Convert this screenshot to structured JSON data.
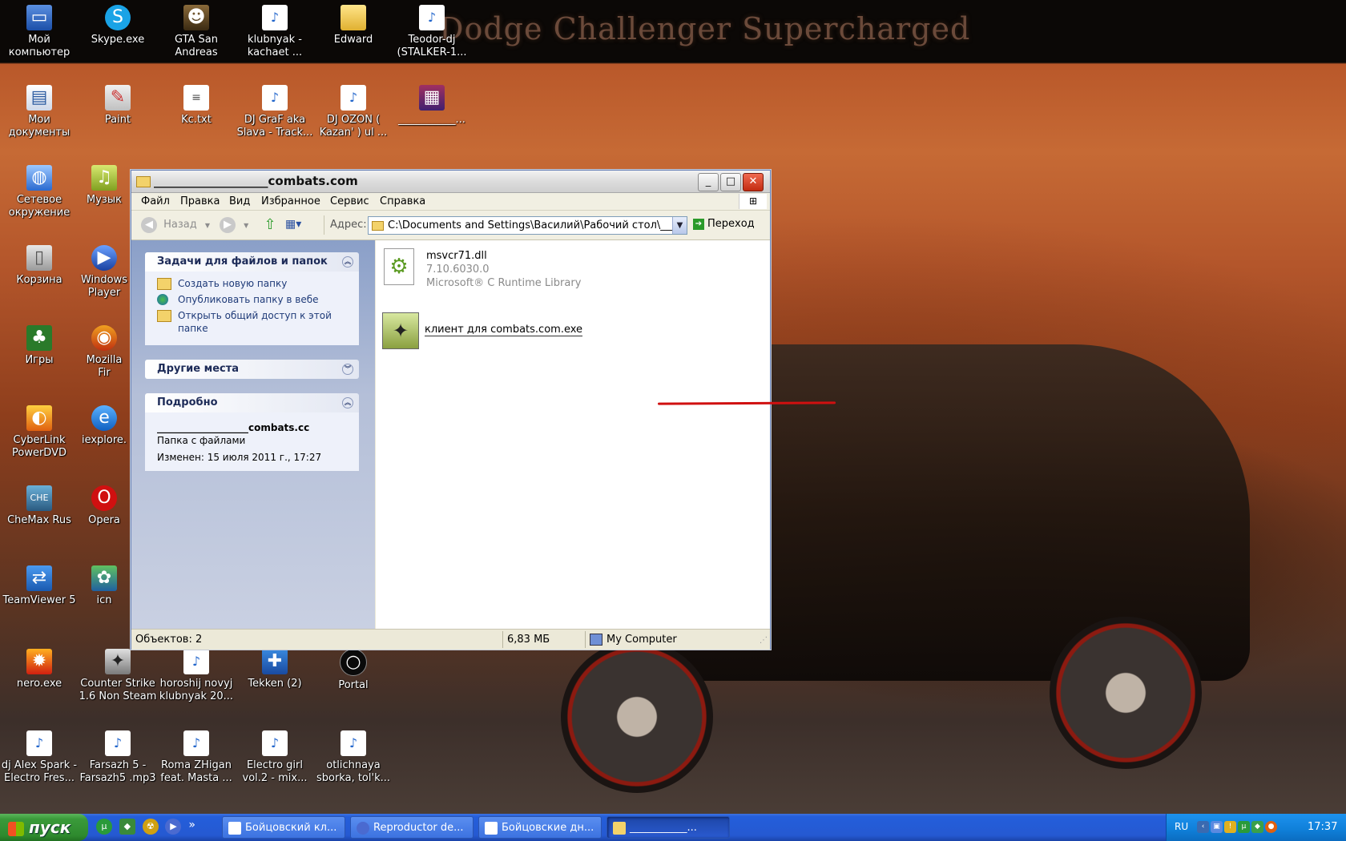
{
  "wallpaper": {
    "banner": "Dodge Challenger Supercharged"
  },
  "desktop": {
    "icons": [
      {
        "label": "Мой компьютер",
        "icon": "computer-icon"
      },
      {
        "label": "Skype.exe",
        "icon": "skype-icon"
      },
      {
        "label": "GTA San Andreas",
        "icon": "game-icon"
      },
      {
        "label": "klubnyak - kachaet ...",
        "icon": "mp3-icon"
      },
      {
        "label": "Edward",
        "icon": "folder-icon"
      },
      {
        "label": "Teodor-dj (STALKER-1...",
        "icon": "mp3-icon"
      },
      {
        "label": "Мои документы",
        "icon": "documents-icon"
      },
      {
        "label": "Paint",
        "icon": "paint-icon"
      },
      {
        "label": "Kc.txt",
        "icon": "text-file-icon"
      },
      {
        "label": "DJ GraF aka Slava - Track...",
        "icon": "mp3-icon"
      },
      {
        "label": "DJ OZON ( Kazan' ) ul ...",
        "icon": "mp3-icon"
      },
      {
        "label": "___________...",
        "icon": "archive-icon"
      },
      {
        "label": "Сетевое окружение",
        "icon": "network-icon"
      },
      {
        "label": "Музык",
        "icon": "music-icon"
      },
      {
        "label": "Корзина",
        "icon": "recycle-bin-icon"
      },
      {
        "label": "Windows Player",
        "icon": "media-player-icon"
      },
      {
        "label": "Игры",
        "icon": "games-icon"
      },
      {
        "label": "Mozilla Fir",
        "icon": "firefox-icon"
      },
      {
        "label": "CyberLink PowerDVD",
        "icon": "powerdvd-icon"
      },
      {
        "label": "iexplore.",
        "icon": "internet-explorer-icon"
      },
      {
        "label": "CheMax Rus",
        "icon": "chemax-icon"
      },
      {
        "label": "Opera",
        "icon": "opera-icon"
      },
      {
        "label": "TeamViewer 5",
        "icon": "teamviewer-icon"
      },
      {
        "label": "icn",
        "icon": "icn-icon"
      },
      {
        "label": "nero.exe",
        "icon": "nero-icon"
      },
      {
        "label": "Counter Strike 1.6 Non Steam",
        "icon": "counter-strike-icon"
      },
      {
        "label": "horoshij novyj klubnyak 20...",
        "icon": "mp3-icon"
      },
      {
        "label": "Tekken (2)",
        "icon": "gamepad-icon"
      },
      {
        "label": "Portal",
        "icon": "portal-icon"
      },
      {
        "label": "dj Alex Spark - Electro Fres...",
        "icon": "mp3-icon"
      },
      {
        "label": "Farsazh 5 - Farsazh5 .mp3",
        "icon": "mp3-icon"
      },
      {
        "label": "Roma ZHigan feat. Masta ...",
        "icon": "mp3-icon"
      },
      {
        "label": "Electro girl vol.2 - mix...",
        "icon": "mp3-icon"
      },
      {
        "label": "otlichnaya sborka, tol'k...",
        "icon": "mp3-icon"
      }
    ]
  },
  "window": {
    "title": "___________________combats.com",
    "menu": [
      "Файл",
      "Правка",
      "Вид",
      "Избранное",
      "Сервис",
      "Справка"
    ],
    "toolbar": {
      "back": "Назад",
      "address_label": "Адрес:",
      "address": "C:\\Documents and Settings\\Василий\\Рабочий стол\\____",
      "go": "Переход"
    },
    "tasks": {
      "header": "Задачи для файлов и папок",
      "items": [
        "Создать новую папку",
        "Опубликовать папку в вебе",
        "Открыть общий доступ к этой папке"
      ]
    },
    "other_places": {
      "header": "Другие места"
    },
    "details": {
      "header": "Подробно",
      "name": "___________________combats.cc",
      "type": "Папка с файлами",
      "modified": "Изменен: 15 июля 2011 г., 17:27"
    },
    "files": [
      {
        "name": "msvcr71.dll",
        "version": "7.10.6030.0",
        "description": "Microsoft® C Runtime Library"
      },
      {
        "name": "клиент для combats.com.exe"
      }
    ],
    "status": {
      "objects": "Объектов: 2",
      "size": "6,83 МБ",
      "location": "My Computer"
    }
  },
  "taskbar": {
    "start": "пуск",
    "tasks": [
      "Бойцовский кл...",
      "Reproductor de...",
      "Бойцовские дн...",
      "___________..."
    ],
    "lang": "RU",
    "clock": "17:37"
  }
}
